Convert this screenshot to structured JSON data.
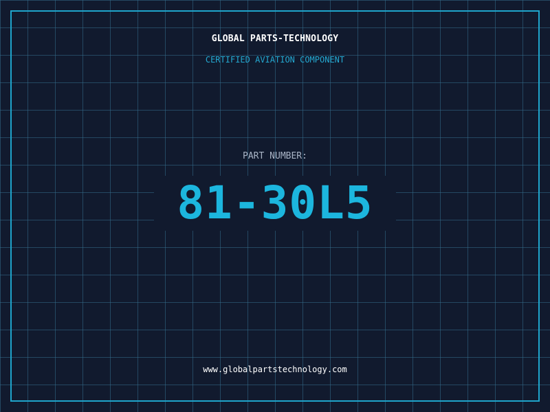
{
  "label": {
    "company": "GLOBAL PARTS-TECHNOLOGY",
    "certification": "CERTIFIED AVIATION COMPONENT",
    "part_number_label": "PART NUMBER:",
    "part_number": "81-30L5",
    "website": "www.globalpartstechnology.com"
  },
  "colors": {
    "background": "#111a2e",
    "grid": "#346e8c",
    "accent": "#1fa6cc",
    "text_primary": "#ffffff",
    "text_muted": "#a9b4c6"
  }
}
